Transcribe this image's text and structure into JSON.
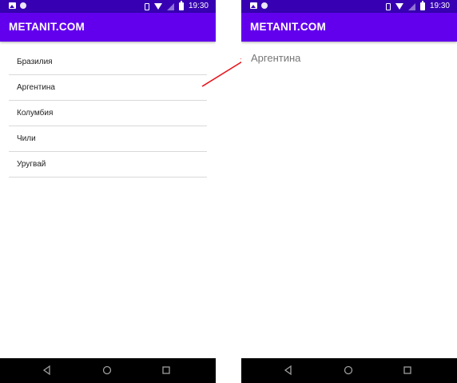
{
  "left_screen": {
    "status_bar": {
      "time": "19:30"
    },
    "app_bar": {
      "title": "METANIT.COM"
    },
    "list": {
      "items": [
        "Бразилия",
        "Аргентина",
        "Колумбия",
        "Чили",
        "Уругвай"
      ]
    }
  },
  "right_screen": {
    "status_bar": {
      "time": "19:30"
    },
    "app_bar": {
      "title": "METANIT.COM"
    },
    "detail": {
      "text": "Аргентина"
    }
  },
  "colors": {
    "status_bar": "#3700b3",
    "app_bar": "#6200ee",
    "arrow": "#e8141b",
    "nav_bar": "#000000"
  },
  "icons": [
    "image-icon",
    "circle-icon",
    "vibrate-icon",
    "wifi-icon",
    "no-signal-icon",
    "battery-icon",
    "back-icon",
    "home-icon",
    "recents-icon",
    "arrow-icon"
  ]
}
